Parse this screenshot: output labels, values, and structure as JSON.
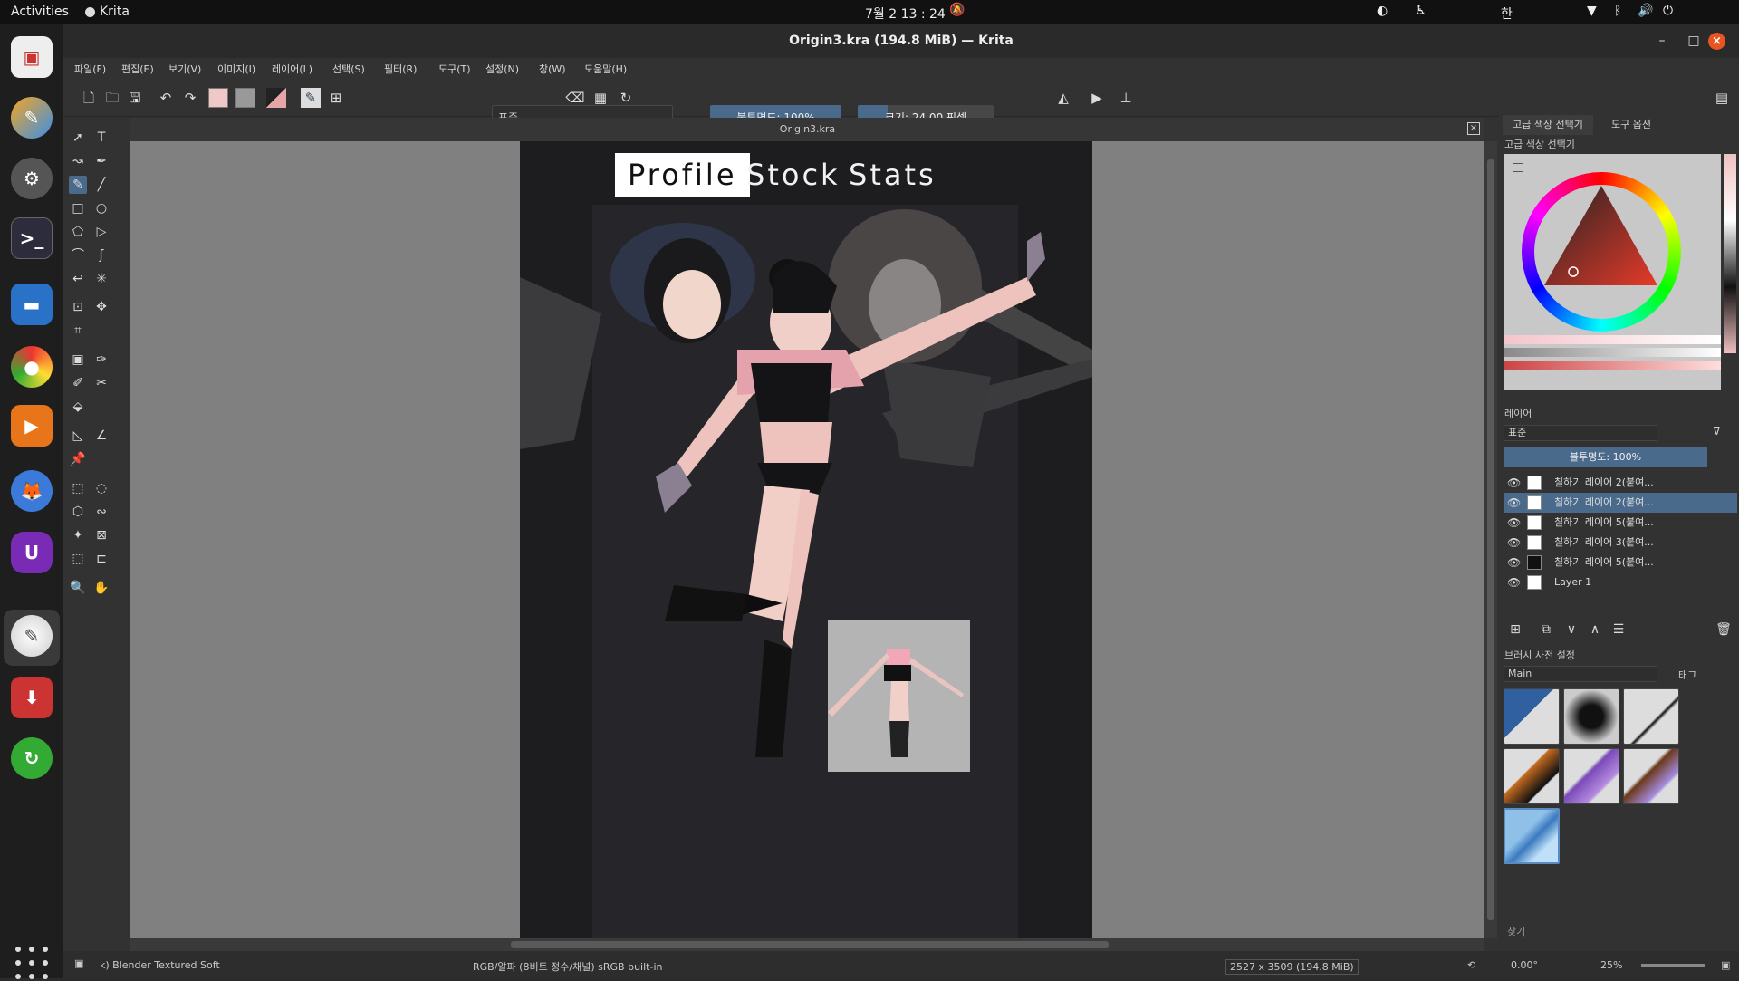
{
  "system": {
    "activities": "Activities",
    "app_name": "Krita",
    "clock": "7월 2  13 : 24",
    "ime": "한"
  },
  "window": {
    "title": "Origin3.kra (194.8 MiB) — Krita",
    "minimize": "–",
    "maximize": "□",
    "close": "×"
  },
  "menu": [
    "파일(F)",
    "편집(E)",
    "보기(V)",
    "이미지(I)",
    "레이어(L)",
    "선택(S)",
    "필터(R)",
    "도구(T)",
    "설정(N)",
    "창(W)",
    "도움말(H)"
  ],
  "toolbar": {
    "blend_mode": "표준",
    "opacity": "불투명도: 100%",
    "size": "크기: 24.00 픽셀"
  },
  "document": {
    "tab_title": "Origin3.kra",
    "close": "×"
  },
  "artwork": {
    "tabs": [
      "Profile",
      "Stock",
      "Stats"
    ],
    "selected_tab": "Profile"
  },
  "right_panel": {
    "tabs": [
      "고급 색상 선택기",
      "도구 옵션"
    ],
    "color_header": "고급 색상 선택기",
    "layers_header": "레이어",
    "layers_blend": "표준",
    "layers_opacity": "불투명도:  100%",
    "layers": [
      "칠하기 레이어 2(붙여...",
      "칠하기 레이어 2(붙여...",
      "칠하기 레이어 5(붙여...",
      "칠하기 레이어 3(붙여...",
      "칠하기 레이어 5(붙여...",
      "Layer 1"
    ],
    "selected_layer_index": 1,
    "brush_header": "브러시 사전 설정",
    "brush_tag": "Main",
    "brush_tag_btn": "태그",
    "search": "찾기"
  },
  "status": {
    "brush": "k) Blender Textured Soft",
    "color_space": "RGB/알파 (8비트 정수/채널)  sRGB built-in",
    "dimensions": "2527 x 3509 (194.8 MiB)",
    "rotation": "0.00°",
    "zoom": "25%"
  },
  "colors": {
    "accent": "#4a6a8c",
    "close": "#e95420"
  }
}
